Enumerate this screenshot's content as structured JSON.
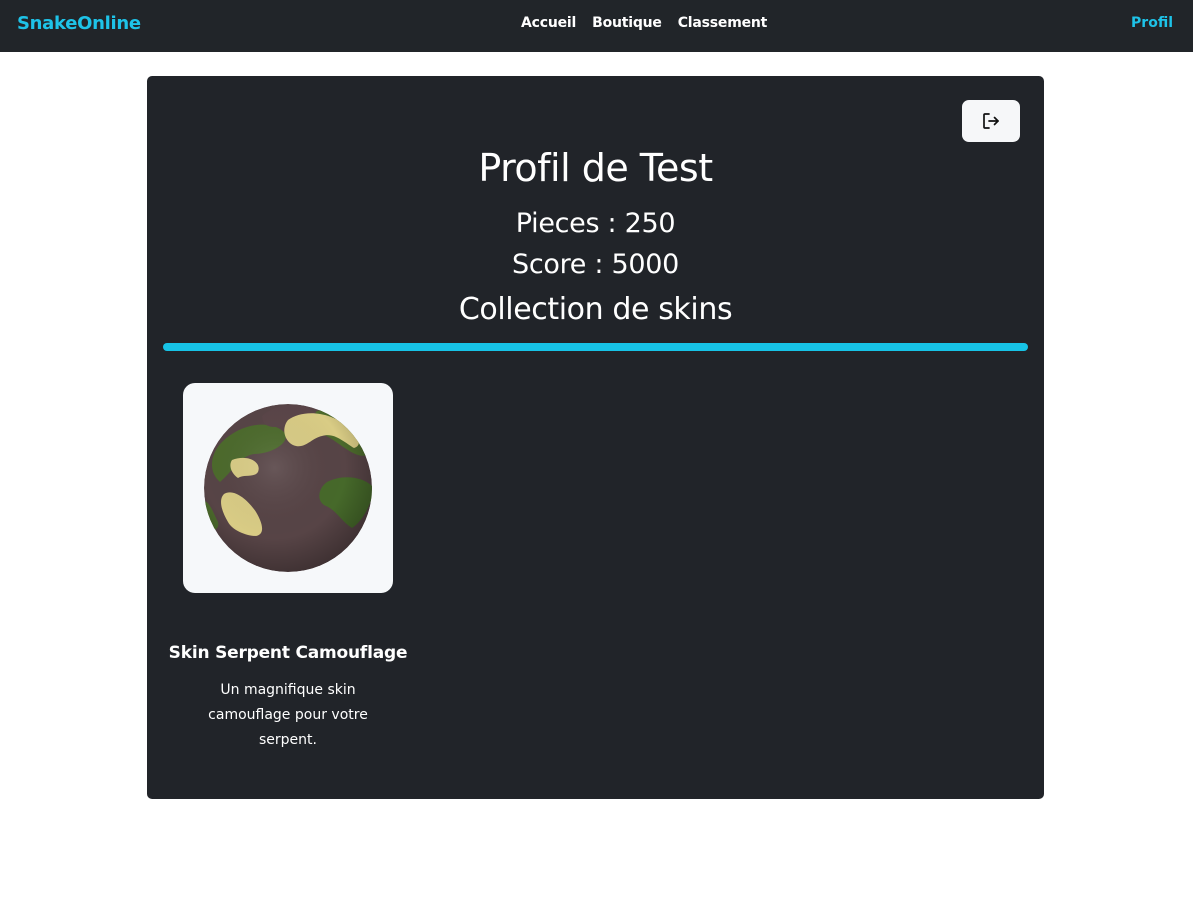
{
  "navbar": {
    "brand": "SnakeOnline",
    "links": [
      "Accueil",
      "Boutique",
      "Classement"
    ],
    "profile_link": "Profil",
    "brand_color": "#1ec3e8",
    "background": "#212529"
  },
  "profile": {
    "logout_icon": "logout-icon",
    "title": "Profil de Test",
    "coins_line": "Pieces : 250",
    "score_line": "Score : 5000",
    "collection_title": "Collection de skins",
    "accent_color": "#17c3e6"
  },
  "skins": [
    {
      "name": "Skin Serpent Camouflage",
      "description": "Un magnifique skin camouflage pour votre serpent.",
      "image_icon": "camouflage-ball-icon"
    }
  ]
}
